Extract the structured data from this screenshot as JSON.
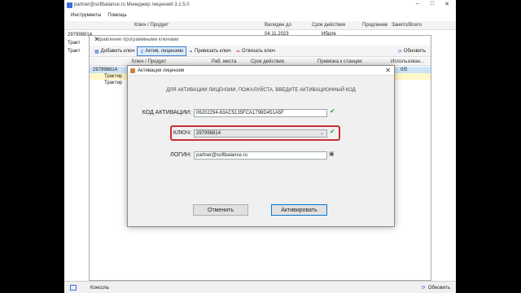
{
  "main": {
    "title": "partner@softbalance.ru Менеджер лицензий 3.1.5.0",
    "menu": [
      "Инструменты",
      "Помощь"
    ],
    "columns": [
      "Ключ / Продукт",
      "Валиден до",
      "Срок действия",
      "Продление",
      "Занято/Всего"
    ],
    "tree": [
      "297998814",
      "Тракт",
      "Тракт"
    ],
    "bg_values": [
      "04.11.2023",
      "Ибдле"
    ],
    "status_console": "Консоль",
    "status_refresh": "Обновить"
  },
  "mgmt": {
    "title": "Управление программными ключами",
    "toolbar": {
      "add": "Добавить ключ",
      "activate": "Актив. лицензию",
      "bind": "Привязать ключ",
      "unbind": "Отвязать ключ",
      "refresh": "Обновить"
    },
    "columns": [
      "Ключ / Продукт",
      "Раб. места",
      "Срок действия",
      "Привязка к станции",
      "Использован..."
    ],
    "rows": [
      {
        "name": "297996814",
        "used": "0/5"
      },
      {
        "name": "Трактир",
        "used": ""
      },
      {
        "name": "Трактир",
        "used": ""
      }
    ]
  },
  "activation": {
    "title": "Активация лицензии",
    "prompt": "ДЛЯ АКТИВАЦИИ ЛИЦЕНЗИИ, ПОЖАЛУЙСТА, ВВЕДИТЕ АКТИВАЦИОННЫЙ КОД",
    "code_label": "КОД АКТИВАЦИИ:",
    "code_value": "06202294-63AC5135FCA1798D451A5F",
    "key_label": "КЛЮЧ:",
    "key_value": "297996814",
    "login_label": "ЛОГИН:",
    "login_value": "partner@softbalance.ru",
    "cancel": "Отменить",
    "activate": "Активировать"
  },
  "icons": {
    "check": "check-icon",
    "lock": "lock-icon",
    "refresh": "refresh-icon",
    "dropdown": "chevron-down-icon"
  },
  "colors": {
    "highlight": "#c82f2f",
    "accent": "#0078d7",
    "check": "#2d9d3a"
  }
}
